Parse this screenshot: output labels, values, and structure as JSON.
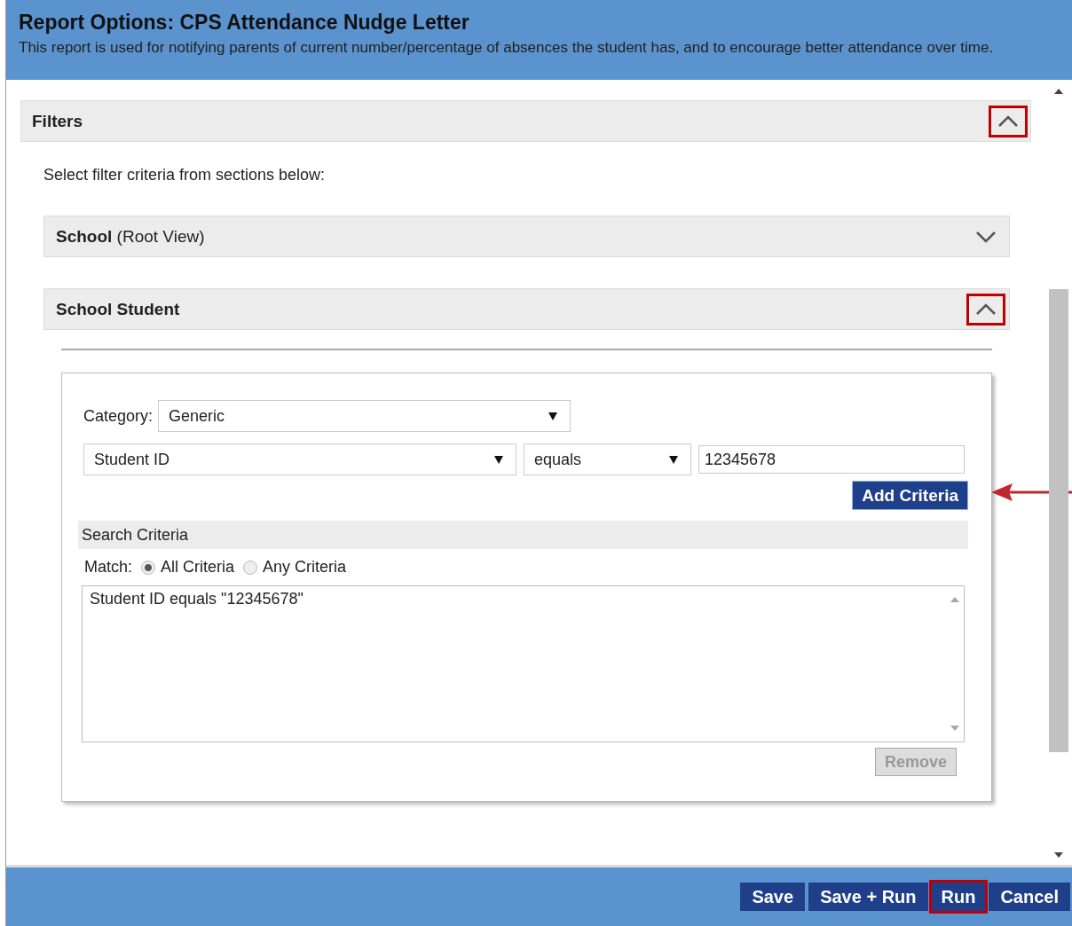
{
  "window": {
    "title": "Report Options: CPS Attendance Nudge Letter",
    "description": "This report is used for notifying parents of current number/percentage of absences the student has, and to encourage better attendance over time."
  },
  "filters": {
    "title": "Filters",
    "expanded": true,
    "highlighted": true,
    "instruction": "Select filter criteria from sections below:",
    "sections": [
      {
        "title": "**School** (Root View)",
        "expanded": false,
        "highlighted": false
      },
      {
        "title": "**School Student**",
        "expanded": true,
        "highlighted": true
      }
    ]
  },
  "criteria": {
    "category_label": "Category:",
    "category": "Generic",
    "field": "Student ID",
    "operator": "equals",
    "value": "12345678",
    "add_button": "Add Criteria",
    "add_pointed": true,
    "search_title": "Search Criteria",
    "match_label": "Match:",
    "match_options": [
      {
        "label": "All Criteria",
        "selected": true
      },
      {
        "label": "Any Criteria",
        "selected": false
      }
    ],
    "list_text": "Student ID equals \"12345678\"",
    "remove_button": "Remove",
    "remove_disabled": true
  },
  "buttons": [
    {
      "label": "Save",
      "highlighted": false
    },
    {
      "label": "Save + Run",
      "highlighted": false
    },
    {
      "label": "Run",
      "highlighted": true
    },
    {
      "label": "Cancel",
      "highlighted": false
    }
  ]
}
